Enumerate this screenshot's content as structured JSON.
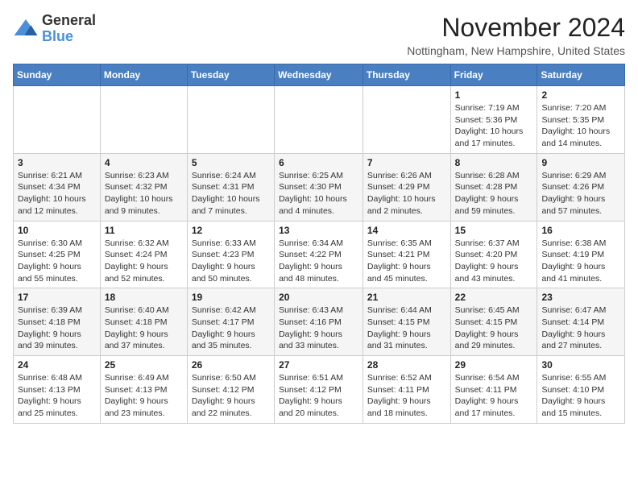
{
  "logo": {
    "general": "General",
    "blue": "Blue"
  },
  "title": "November 2024",
  "location": "Nottingham, New Hampshire, United States",
  "days_of_week": [
    "Sunday",
    "Monday",
    "Tuesday",
    "Wednesday",
    "Thursday",
    "Friday",
    "Saturday"
  ],
  "weeks": [
    [
      {
        "day": "",
        "info": ""
      },
      {
        "day": "",
        "info": ""
      },
      {
        "day": "",
        "info": ""
      },
      {
        "day": "",
        "info": ""
      },
      {
        "day": "",
        "info": ""
      },
      {
        "day": "1",
        "info": "Sunrise: 7:19 AM\nSunset: 5:36 PM\nDaylight: 10 hours and 17 minutes."
      },
      {
        "day": "2",
        "info": "Sunrise: 7:20 AM\nSunset: 5:35 PM\nDaylight: 10 hours and 14 minutes."
      }
    ],
    [
      {
        "day": "3",
        "info": "Sunrise: 6:21 AM\nSunset: 4:34 PM\nDaylight: 10 hours and 12 minutes."
      },
      {
        "day": "4",
        "info": "Sunrise: 6:23 AM\nSunset: 4:32 PM\nDaylight: 10 hours and 9 minutes."
      },
      {
        "day": "5",
        "info": "Sunrise: 6:24 AM\nSunset: 4:31 PM\nDaylight: 10 hours and 7 minutes."
      },
      {
        "day": "6",
        "info": "Sunrise: 6:25 AM\nSunset: 4:30 PM\nDaylight: 10 hours and 4 minutes."
      },
      {
        "day": "7",
        "info": "Sunrise: 6:26 AM\nSunset: 4:29 PM\nDaylight: 10 hours and 2 minutes."
      },
      {
        "day": "8",
        "info": "Sunrise: 6:28 AM\nSunset: 4:28 PM\nDaylight: 9 hours and 59 minutes."
      },
      {
        "day": "9",
        "info": "Sunrise: 6:29 AM\nSunset: 4:26 PM\nDaylight: 9 hours and 57 minutes."
      }
    ],
    [
      {
        "day": "10",
        "info": "Sunrise: 6:30 AM\nSunset: 4:25 PM\nDaylight: 9 hours and 55 minutes."
      },
      {
        "day": "11",
        "info": "Sunrise: 6:32 AM\nSunset: 4:24 PM\nDaylight: 9 hours and 52 minutes."
      },
      {
        "day": "12",
        "info": "Sunrise: 6:33 AM\nSunset: 4:23 PM\nDaylight: 9 hours and 50 minutes."
      },
      {
        "day": "13",
        "info": "Sunrise: 6:34 AM\nSunset: 4:22 PM\nDaylight: 9 hours and 48 minutes."
      },
      {
        "day": "14",
        "info": "Sunrise: 6:35 AM\nSunset: 4:21 PM\nDaylight: 9 hours and 45 minutes."
      },
      {
        "day": "15",
        "info": "Sunrise: 6:37 AM\nSunset: 4:20 PM\nDaylight: 9 hours and 43 minutes."
      },
      {
        "day": "16",
        "info": "Sunrise: 6:38 AM\nSunset: 4:19 PM\nDaylight: 9 hours and 41 minutes."
      }
    ],
    [
      {
        "day": "17",
        "info": "Sunrise: 6:39 AM\nSunset: 4:18 PM\nDaylight: 9 hours and 39 minutes."
      },
      {
        "day": "18",
        "info": "Sunrise: 6:40 AM\nSunset: 4:18 PM\nDaylight: 9 hours and 37 minutes."
      },
      {
        "day": "19",
        "info": "Sunrise: 6:42 AM\nSunset: 4:17 PM\nDaylight: 9 hours and 35 minutes."
      },
      {
        "day": "20",
        "info": "Sunrise: 6:43 AM\nSunset: 4:16 PM\nDaylight: 9 hours and 33 minutes."
      },
      {
        "day": "21",
        "info": "Sunrise: 6:44 AM\nSunset: 4:15 PM\nDaylight: 9 hours and 31 minutes."
      },
      {
        "day": "22",
        "info": "Sunrise: 6:45 AM\nSunset: 4:15 PM\nDaylight: 9 hours and 29 minutes."
      },
      {
        "day": "23",
        "info": "Sunrise: 6:47 AM\nSunset: 4:14 PM\nDaylight: 9 hours and 27 minutes."
      }
    ],
    [
      {
        "day": "24",
        "info": "Sunrise: 6:48 AM\nSunset: 4:13 PM\nDaylight: 9 hours and 25 minutes."
      },
      {
        "day": "25",
        "info": "Sunrise: 6:49 AM\nSunset: 4:13 PM\nDaylight: 9 hours and 23 minutes."
      },
      {
        "day": "26",
        "info": "Sunrise: 6:50 AM\nSunset: 4:12 PM\nDaylight: 9 hours and 22 minutes."
      },
      {
        "day": "27",
        "info": "Sunrise: 6:51 AM\nSunset: 4:12 PM\nDaylight: 9 hours and 20 minutes."
      },
      {
        "day": "28",
        "info": "Sunrise: 6:52 AM\nSunset: 4:11 PM\nDaylight: 9 hours and 18 minutes."
      },
      {
        "day": "29",
        "info": "Sunrise: 6:54 AM\nSunset: 4:11 PM\nDaylight: 9 hours and 17 minutes."
      },
      {
        "day": "30",
        "info": "Sunrise: 6:55 AM\nSunset: 4:10 PM\nDaylight: 9 hours and 15 minutes."
      }
    ]
  ]
}
